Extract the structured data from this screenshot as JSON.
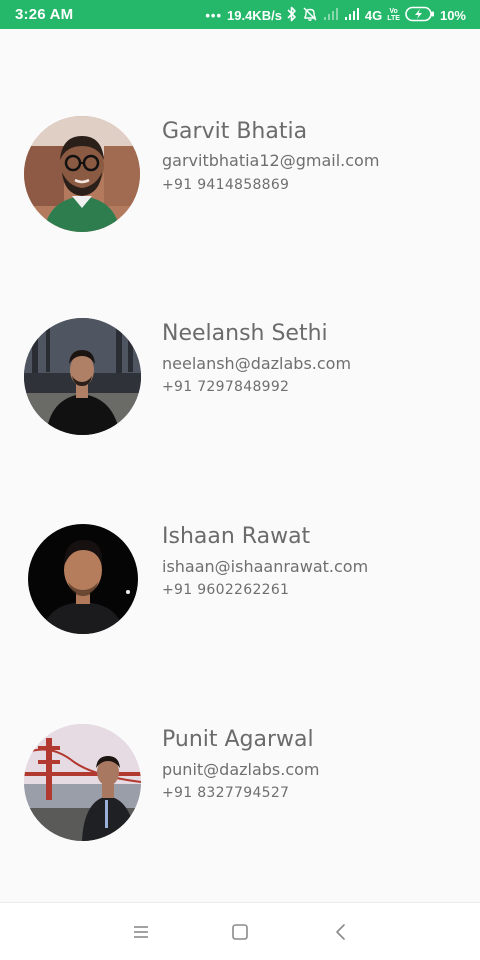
{
  "status_bar": {
    "time": "3:26 AM",
    "network_speed": "19.4KB/s",
    "network_type": "4G",
    "volte_label_top": "Vo",
    "volte_label_bottom": "LTE",
    "battery_percent": "10%",
    "background_color": "#25b86a",
    "icons": [
      "more-dots-icon",
      "bluetooth-icon",
      "alarm-off-icon",
      "signal-icon",
      "signal-icon",
      "volte-icon",
      "battery-charging-icon"
    ]
  },
  "contacts": [
    {
      "name": "Garvit Bhatia",
      "email": "garvitbhatia12@gmail.com",
      "phone": "+91 9414858869"
    },
    {
      "name": "Neelansh Sethi",
      "email": "neelansh@dazlabs.com",
      "phone": "+91 7297848992"
    },
    {
      "name": "Ishaan Rawat",
      "email": "ishaan@ishaanrawat.com",
      "phone": "+91 9602262261"
    },
    {
      "name": "Punit Agarwal",
      "email": "punit@dazlabs.com",
      "phone": "+91 8327794527"
    }
  ],
  "nav_bar": {
    "icons": [
      "menu-icon",
      "home-icon",
      "back-icon"
    ]
  }
}
